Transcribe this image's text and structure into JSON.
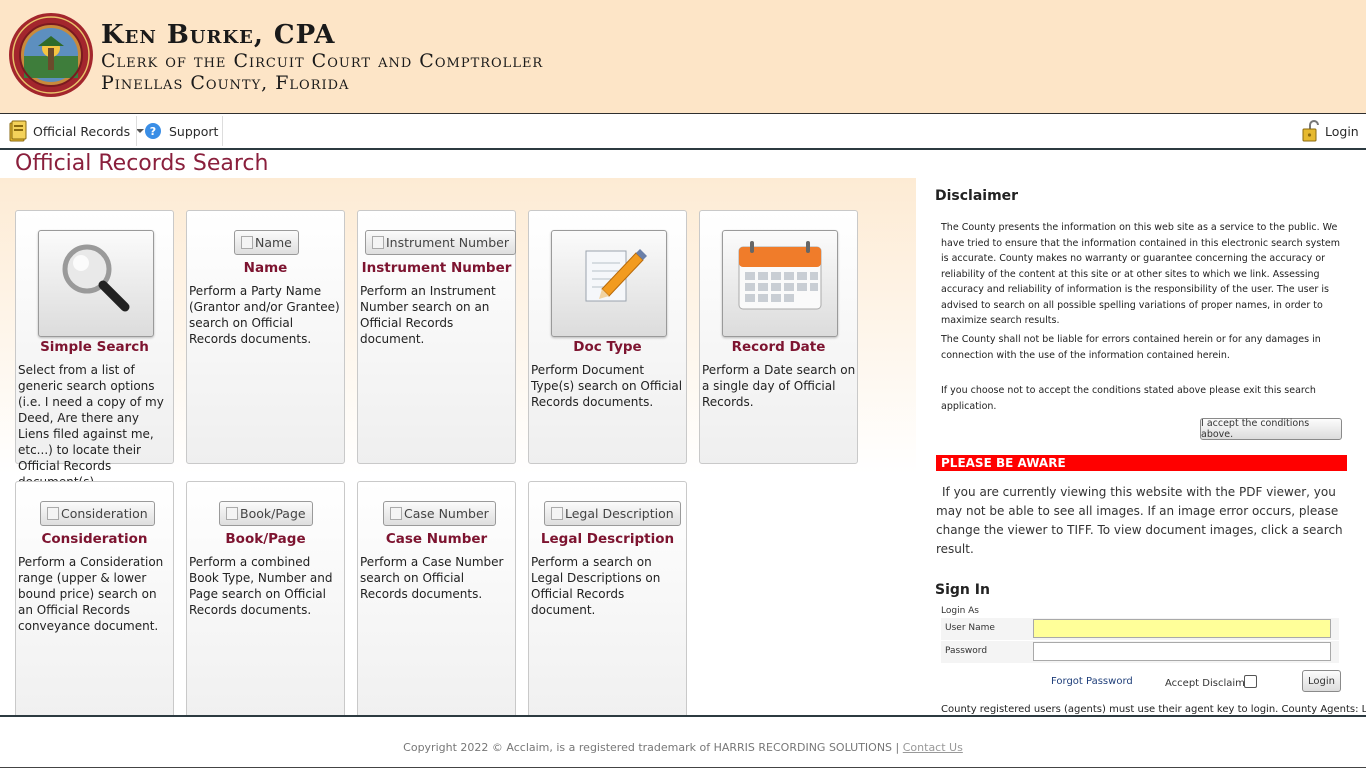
{
  "header": {
    "name": "Ken Burke, CPA",
    "line2": "Clerk of the Circuit Court and Comptroller",
    "line3": "Pinellas County, Florida"
  },
  "nav": {
    "official_records": "Official Records",
    "support": "Support",
    "login": "Login"
  },
  "page_title": "Official Records Search",
  "cards": [
    {
      "title": "Simple Search",
      "button": "",
      "desc": "Select from a list of generic search options (i.e. I need a copy of my Deed, Are there any Liens filed against me, etc...) to locate their Official Records document(s)."
    },
    {
      "title": "Name",
      "button": "Name",
      "desc": "Perform a Party Name (Grantor and/or Grantee) search on Official Records documents."
    },
    {
      "title": "Instrument Number",
      "button": "Instrument Number",
      "desc": "Perform an Instrument Number search on an Official Records document."
    },
    {
      "title": "Doc Type",
      "button": "",
      "desc": "Perform Document Type(s) search on Official Records documents."
    },
    {
      "title": "Record Date",
      "button": "",
      "desc": "Perform a Date search on a single day of Official Records."
    },
    {
      "title": "Consideration",
      "button": "Consideration",
      "desc": "Perform a Consideration range (upper & lower bound price) search on an Official Records conveyance document."
    },
    {
      "title": "Book/Page",
      "button": "Book/Page",
      "desc": "Perform a combined Book Type, Number and Page search on Official Records documents."
    },
    {
      "title": "Case Number",
      "button": "Case Number",
      "desc": "Perform a Case Number search on Official Records documents."
    },
    {
      "title": "Legal Description",
      "button": "Legal Description",
      "desc": "Perform a search on Legal Descriptions on Official Records document."
    }
  ],
  "disclaimer": {
    "heading": "Disclaimer",
    "p1": "The County presents the information on this web site as a service to the public. We have tried to ensure that the information contained in this electronic search system is accurate. County makes no warranty or guarantee concerning the accuracy or reliability of the content at this site or at other sites to which we link. Assessing accuracy and reliability of information is the responsibility of the user. The user is advised to search on all possible spelling variations of proper names, in order to maximize search results.",
    "p2": "The County shall not be liable for errors contained herein or for any damages in connection with the use of the information contained herein.",
    "p3": "If you choose not to accept the conditions stated above please exit this search application.",
    "accept_button": "I accept the conditions above."
  },
  "aware": {
    "heading": "PLEASE BE AWARE",
    "text": "If you are currently viewing this website with the PDF viewer, you may not be able to see all images. If an image error occurs, please change the viewer to TIFF. To view document images, click a search result."
  },
  "signin": {
    "heading": "Sign In",
    "login_as": "Login As",
    "username_label": "User Name",
    "password_label": "Password",
    "username_value": "",
    "password_value": "",
    "forgot": "Forgot Password",
    "accept_disclaimer": "Accept Disclaimer",
    "login_button": "Login",
    "agents_note": "County registered users (agents) must use their agent key to login. County Agents: Login"
  },
  "footer": {
    "copyright": "Copyright 2022 © Acclaim, is a registered trademark of HARRIS RECORDING SOLUTIONS | ",
    "contact": "Contact Us"
  },
  "colors": {
    "header_bg": "#fde5c7",
    "title_maroon": "#8a1f3c",
    "aware_red": "#ff0000",
    "input_highlight": "#ffff99"
  }
}
